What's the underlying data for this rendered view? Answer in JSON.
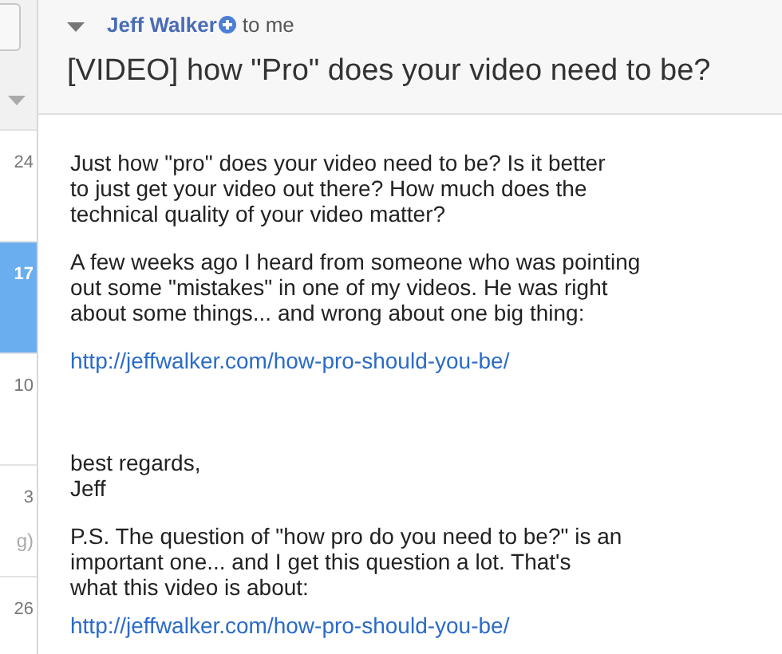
{
  "message_list": {
    "rows": [
      {
        "time": "24",
        "selected": false
      },
      {
        "time": "17",
        "selected": true
      },
      {
        "time": "10",
        "selected": false
      },
      {
        "time": "3",
        "snippet": "g)",
        "selected": false
      },
      {
        "time": "26",
        "selected": false
      }
    ]
  },
  "message": {
    "sender": "Jeff Walker",
    "recipient": "to me",
    "subject": "[VIDEO] how \"Pro\" does your video need to be?",
    "body": [
      {
        "kind": "paragraph",
        "lines": [
          "Just how \"pro\" does your video need to be? Is it better",
          "to just get your video out there? How much does the",
          "technical quality of your video matter?"
        ]
      },
      {
        "kind": "paragraph",
        "lines": [
          "A few weeks ago I heard from someone who was pointing",
          "out some \"mistakes\" in one of my videos. He was right",
          "about some things... and wrong about one big thing:"
        ]
      },
      {
        "kind": "link",
        "lines": [
          "http://jeffwalker.com/how-pro-should-you-be/"
        ]
      },
      {
        "kind": "signature",
        "lines": [
          "best regards,",
          "Jeff"
        ]
      },
      {
        "kind": "paragraph",
        "lines": [
          "P.S. The question of \"how pro do you need to be?\" is an",
          "important one... and I get this question a lot. That's",
          "what this video is about:"
        ]
      },
      {
        "kind": "link",
        "lines": [
          "http://jeffwalker.com/how-pro-should-you-be/"
        ]
      }
    ]
  }
}
